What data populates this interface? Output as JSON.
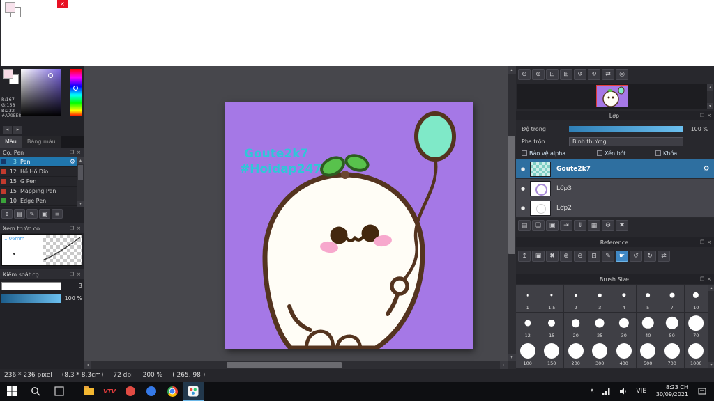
{
  "icons": {
    "popout": "❐",
    "close": "×",
    "gear": "⚙",
    "eye": "●",
    "scroll_up": "▴",
    "scroll_down": "▾",
    "arrow_left": "◂",
    "arrow_right": "▸",
    "chevron_up": "∧"
  },
  "window": {
    "close_glyph": "×"
  },
  "color_panel": {
    "r": "R:167",
    "g": "G:158",
    "b": "B:232",
    "hex": "#A79EE8",
    "tabs": [
      {
        "label": "Màu"
      },
      {
        "label": "Bảng màu"
      }
    ]
  },
  "brush_panel": {
    "title": "Cọ: Pen",
    "brushes": [
      {
        "size": "3",
        "name": "Pen",
        "selected": true,
        "chip": "#16386b"
      },
      {
        "size": "12",
        "name": "Hồ Hồ Dio",
        "selected": false,
        "chip": "#c23b2e"
      },
      {
        "size": "15",
        "name": "G Pen",
        "selected": false,
        "chip": "#c23b2e"
      },
      {
        "size": "15",
        "name": "Mapping Pen",
        "selected": false,
        "chip": "#c23b2e"
      },
      {
        "size": "10",
        "name": "Edge Pen",
        "selected": false,
        "chip": "#3aa33a"
      }
    ],
    "toolbar": [
      {
        "name": "upload-brush-icon",
        "glyph": "↥"
      },
      {
        "name": "new-brush-icon",
        "glyph": "▤"
      },
      {
        "name": "edit-brush-icon",
        "glyph": "✎"
      },
      {
        "name": "brush-folder-icon",
        "glyph": "▣"
      },
      {
        "name": "brush-menu-icon",
        "glyph": "≡"
      }
    ]
  },
  "preview_panel": {
    "title": "Xem trước cọ",
    "size_label": "1.06mm"
  },
  "control_panel": {
    "title": "Kiểm soát cọ",
    "size_value": "3",
    "opacity_value": "100 %"
  },
  "canvas": {
    "watermark_line1": "Goute2k7",
    "watermark_line2": "#Hoidap247"
  },
  "navigator": {
    "toolbar": [
      {
        "name": "zoom-out-icon",
        "glyph": "⊖"
      },
      {
        "name": "zoom-in-icon",
        "glyph": "⊕"
      },
      {
        "name": "fit-view-icon",
        "glyph": "⊡"
      },
      {
        "name": "actual-pixels-icon",
        "glyph": "⊞"
      },
      {
        "name": "rotate-left-icon",
        "glyph": "↺"
      },
      {
        "name": "rotate-right-icon",
        "glyph": "↻"
      },
      {
        "name": "flip-view-icon",
        "glyph": "⇄"
      },
      {
        "name": "reset-view-icon",
        "glyph": "◎"
      }
    ]
  },
  "layers_panel": {
    "title": "Lớp",
    "opacity_label": "Độ trong",
    "opacity_value": "100 %",
    "blend_label": "Pha trộn",
    "blend_value": "Bình thường",
    "options": [
      {
        "name": "protect-alpha-checkbox",
        "label": "Bảo vệ alpha",
        "checked": false
      },
      {
        "name": "clipping-checkbox",
        "label": "Xén bớt",
        "checked": false
      },
      {
        "name": "lock-checkbox",
        "label": "Khóa",
        "checked": false
      }
    ],
    "layers": [
      {
        "name": "Goute2k7",
        "selected": true
      },
      {
        "name": "Lớp3",
        "selected": false
      },
      {
        "name": "Lớp2",
        "selected": false
      }
    ],
    "toolbar": [
      {
        "name": "new-layer-icon",
        "glyph": "▤"
      },
      {
        "name": "duplicate-layer-icon",
        "glyph": "❏"
      },
      {
        "name": "layer-folder-icon",
        "glyph": "▣"
      },
      {
        "name": "transfer-layer-icon",
        "glyph": "⇥"
      },
      {
        "name": "merge-down-icon",
        "glyph": "⇓"
      },
      {
        "name": "flatten-icon",
        "glyph": "▦"
      },
      {
        "name": "layer-settings-icon",
        "glyph": "⚙"
      },
      {
        "name": "delete-layer-icon",
        "glyph": "✖"
      }
    ]
  },
  "reference_panel": {
    "title": "Reference",
    "toolbar": [
      {
        "name": "load-reference-icon",
        "glyph": "↥"
      },
      {
        "name": "reference-folder-icon",
        "glyph": "▣"
      },
      {
        "name": "clear-reference-icon",
        "glyph": "✖"
      },
      {
        "name": "ref-zoom-in-icon",
        "glyph": "⊕"
      },
      {
        "name": "ref-zoom-out-icon",
        "glyph": "⊖"
      },
      {
        "name": "ref-fit-icon",
        "glyph": "⊡"
      },
      {
        "name": "ref-eyedropper-icon",
        "glyph": "✎"
      },
      {
        "name": "ref-hand-tool-icon",
        "glyph": "☛",
        "active": true
      },
      {
        "name": "ref-rotate-left-icon",
        "glyph": "↺"
      },
      {
        "name": "ref-rotate-right-icon",
        "glyph": "↻"
      },
      {
        "name": "ref-flip-icon",
        "glyph": "⇄"
      }
    ]
  },
  "brush_size_panel": {
    "title": "Brush Size",
    "sizes": [
      "1",
      "1.5",
      "2",
      "3",
      "4",
      "5",
      "7",
      "10",
      "12",
      "15",
      "20",
      "25",
      "30",
      "40",
      "50",
      "70",
      "100",
      "150",
      "200",
      "300",
      "400",
      "500",
      "700",
      "1000"
    ]
  },
  "status_bar": {
    "dimensions": "236 * 236 pixel",
    "print_size": "(8.3 * 8.3cm)",
    "dpi": "72 dpi",
    "zoom": "200 %",
    "cursor": "( 265, 98 )"
  },
  "taskbar": {
    "vtv_label": "VTV",
    "language": "VIE",
    "time": "8:23 CH",
    "date": "30/09/2021"
  }
}
